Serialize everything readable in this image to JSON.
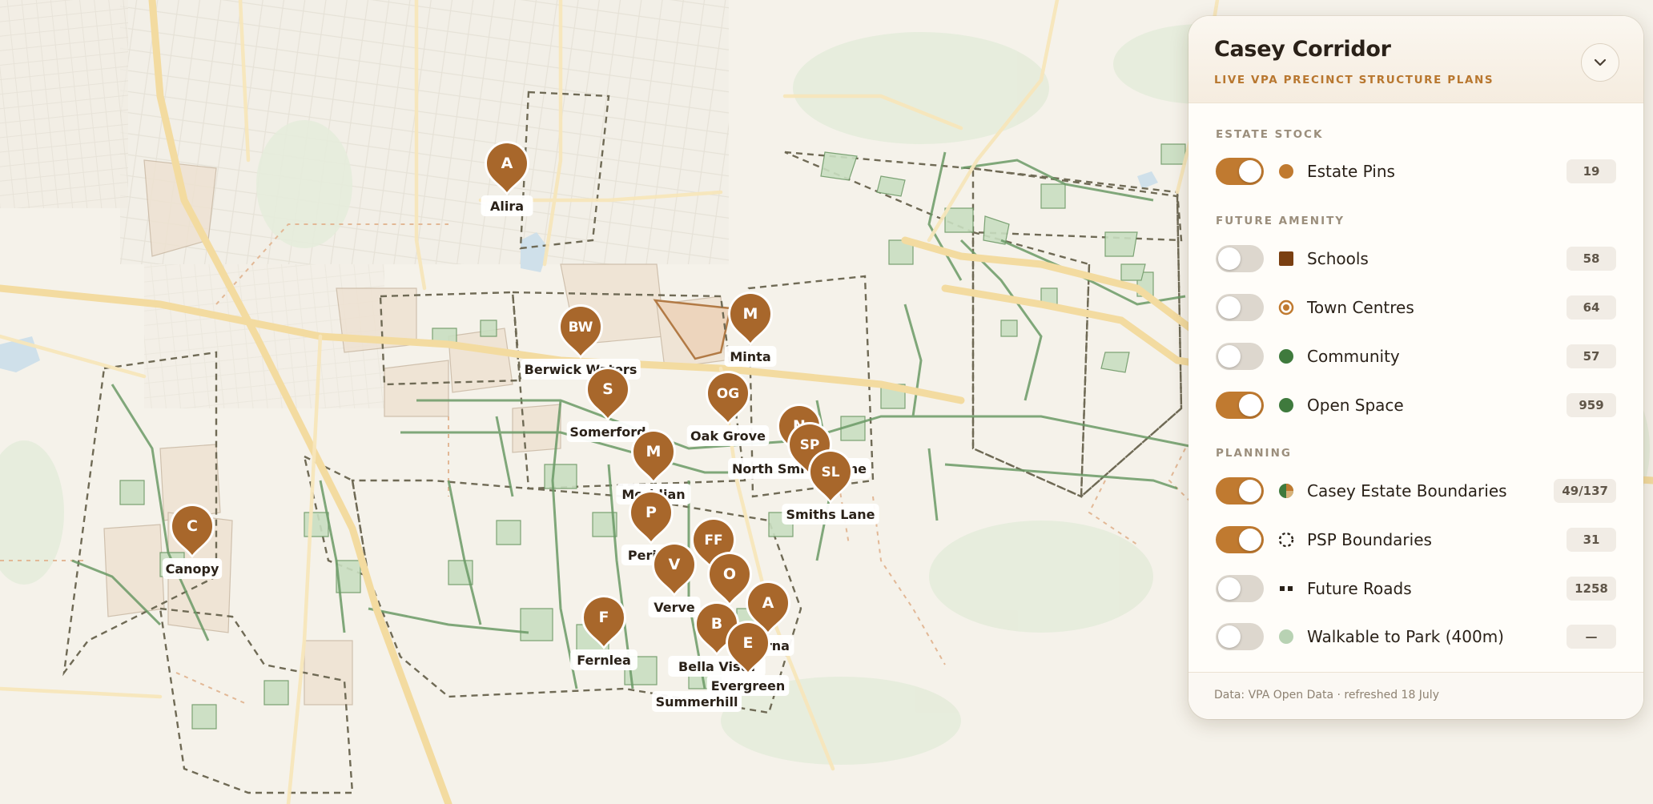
{
  "panel": {
    "title": "Casey Corridor",
    "subtitle": "LIVE VPA PRECINCT STRUCTURE PLANS",
    "collapse_icon": "chevron-down-icon",
    "sections": [
      {
        "label": "ESTATE STOCK",
        "items": [
          {
            "label": "Estate Pins",
            "count": "19",
            "enabled": true,
            "swatch": "circle",
            "color": "#c07a30"
          }
        ]
      },
      {
        "label": "FUTURE AMENITY",
        "items": [
          {
            "label": "Schools",
            "count": "58",
            "enabled": false,
            "swatch": "square",
            "color": "#7a3f12"
          },
          {
            "label": "Town Centres",
            "count": "64",
            "enabled": false,
            "swatch": "ring",
            "color": "#c07a30"
          },
          {
            "label": "Community",
            "count": "57",
            "enabled": false,
            "swatch": "circle",
            "color": "#3f7a3d"
          },
          {
            "label": "Open Space",
            "count": "959",
            "enabled": true,
            "swatch": "circle",
            "color": "#3f7a3d"
          }
        ]
      },
      {
        "label": "PLANNING",
        "items": [
          {
            "label": "Casey Estate Boundaries",
            "count": "49/137",
            "enabled": true,
            "swatch": "pie",
            "color": "#c07a30"
          },
          {
            "label": "PSP Boundaries",
            "count": "31",
            "enabled": true,
            "swatch": "dashed-circle",
            "color": "#2a2118"
          },
          {
            "label": "Future Roads",
            "count": "1258",
            "enabled": false,
            "swatch": "dots",
            "color": "#2a2118"
          },
          {
            "label": "Walkable to Park (400m)",
            "count": "—",
            "enabled": false,
            "swatch": "circle",
            "color": "#b8d2b3"
          }
        ]
      }
    ],
    "footer": "Data: VPA Open Data · refreshed 18 July"
  },
  "estates": [
    {
      "initials": "A",
      "name": "Alira"
    },
    {
      "initials": "BW",
      "name": "Berwick Waters"
    },
    {
      "initials": "M",
      "name": "Minta"
    },
    {
      "initials": "S",
      "name": "Somerford"
    },
    {
      "initials": "OG",
      "name": "Oak Grove"
    },
    {
      "initials": "M",
      "name": "Meridian"
    },
    {
      "initials": "N",
      "name": "North Smiths Lane"
    },
    {
      "initials": "SP",
      "name": ""
    },
    {
      "initials": "SL",
      "name": "Smiths Lane"
    },
    {
      "initials": "C",
      "name": "Canopy"
    },
    {
      "initials": "P",
      "name": "Perina"
    },
    {
      "initials": "FF",
      "name": ""
    },
    {
      "initials": "V",
      "name": "Verve"
    },
    {
      "initials": "O",
      "name": ""
    },
    {
      "initials": "A",
      "name": "Aurna"
    },
    {
      "initials": "F",
      "name": "Fernlea"
    },
    {
      "initials": "B",
      "name": "Bella Vista"
    },
    {
      "initials": "E",
      "name": "Evergreen"
    },
    {
      "initials": "",
      "name": "Summerhill"
    }
  ]
}
